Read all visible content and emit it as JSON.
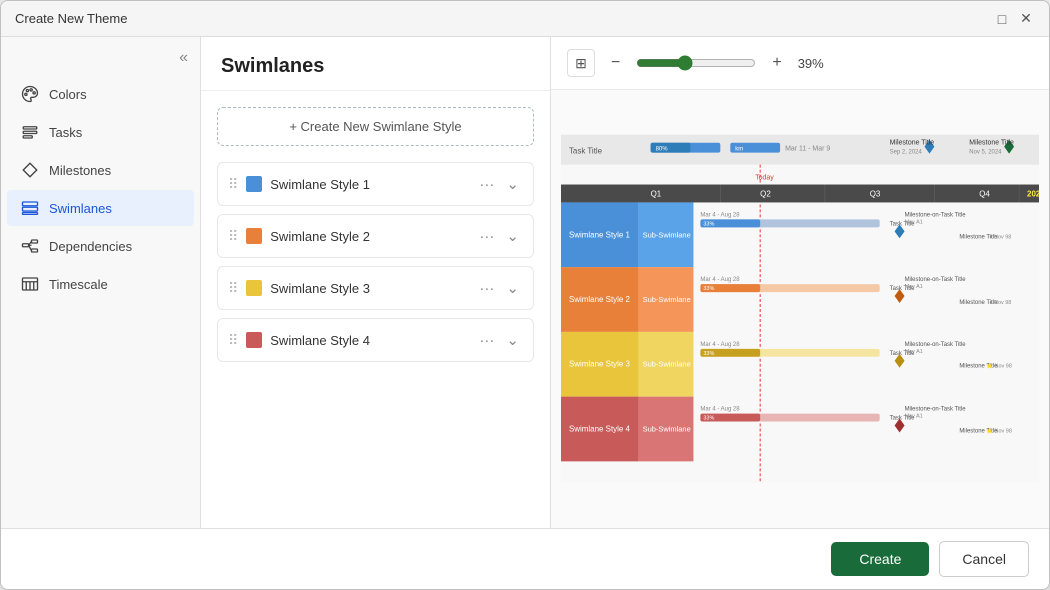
{
  "dialog": {
    "title": "Create New Theme",
    "close_icon": "×",
    "maximize_icon": "□"
  },
  "sidebar": {
    "collapse_icon": "«",
    "items": [
      {
        "id": "colors",
        "label": "Colors",
        "icon": "palette",
        "active": false
      },
      {
        "id": "tasks",
        "label": "Tasks",
        "icon": "tasks",
        "active": false
      },
      {
        "id": "milestones",
        "label": "Milestones",
        "icon": "milestones",
        "active": false
      },
      {
        "id": "swimlanes",
        "label": "Swimlanes",
        "icon": "swimlanes",
        "active": true
      },
      {
        "id": "dependencies",
        "label": "Dependencies",
        "icon": "dependencies",
        "active": false
      },
      {
        "id": "timescale",
        "label": "Timescale",
        "icon": "timescale",
        "active": false
      }
    ]
  },
  "main": {
    "title": "Swimlanes",
    "create_btn_label": "+ Create New Swimlane Style",
    "styles": [
      {
        "id": 1,
        "label": "Swimlane Style 1",
        "color": "#4a90d9"
      },
      {
        "id": 2,
        "label": "Swimlane Style 2",
        "color": "#e8803a"
      },
      {
        "id": 3,
        "label": "Swimlane Style 3",
        "color": "#e8c53a"
      },
      {
        "id": 4,
        "label": "Swimlane Style 4",
        "color": "#c85a5a"
      }
    ]
  },
  "preview": {
    "zoom_value": "39%",
    "zoom_min": 0,
    "zoom_max": 100,
    "zoom_current": 39
  },
  "footer": {
    "create_label": "Create",
    "cancel_label": "Cancel"
  }
}
